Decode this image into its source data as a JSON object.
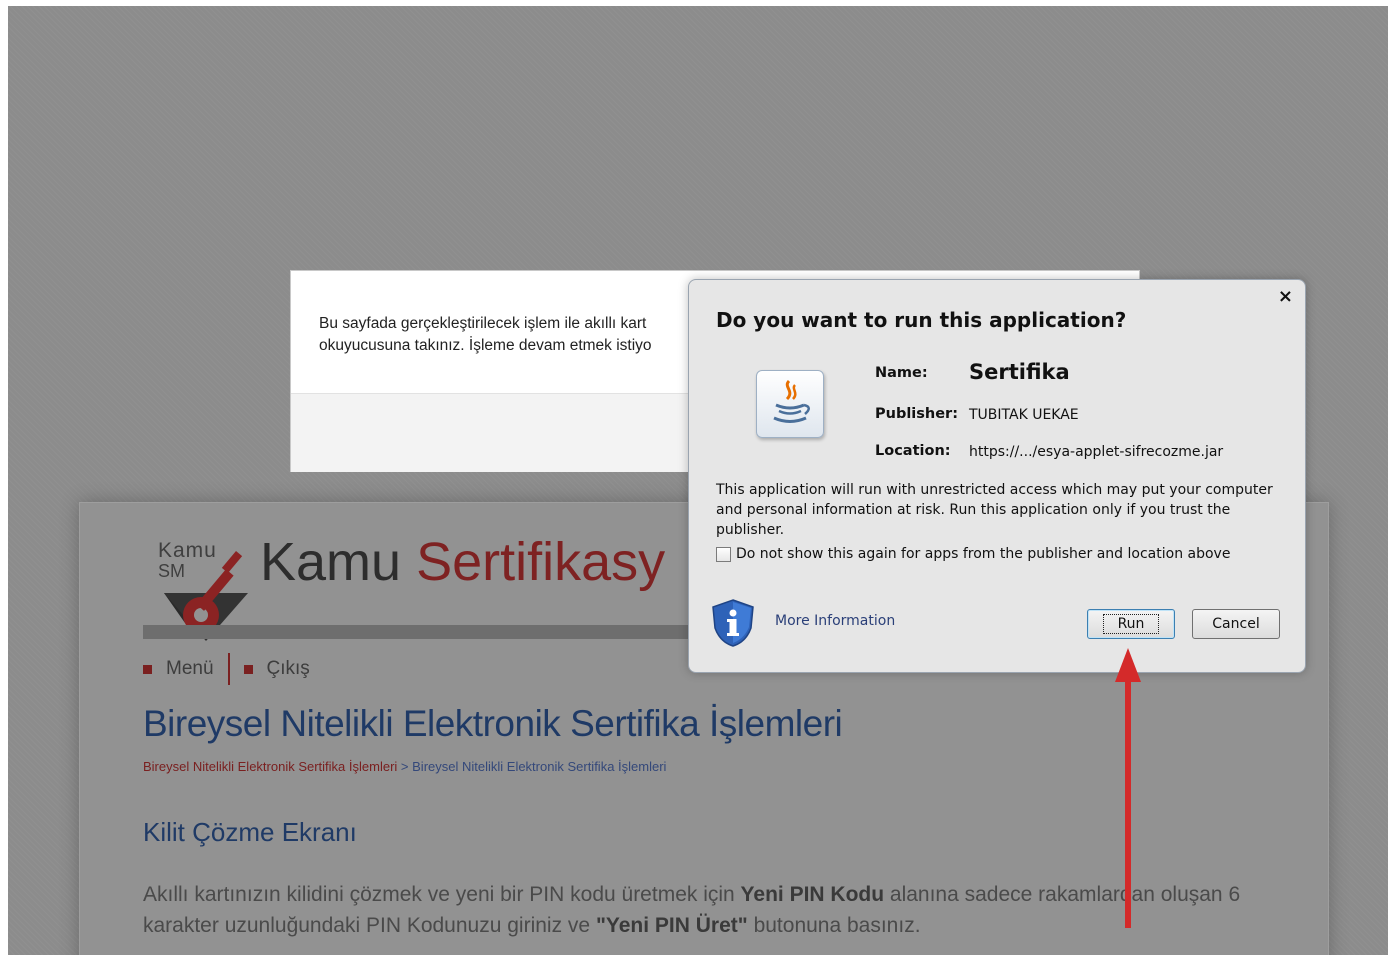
{
  "page": {
    "logo": {
      "small_top": "Kamu",
      "small_bottom": "SM"
    },
    "brand": {
      "part1": "Kamu",
      "part2": "Sertifikasy"
    },
    "nav": {
      "menu": "Menü",
      "exit": "Çıkış"
    },
    "page_title": "Bireysel Nitelikli Elektronik Sertifika İşlemleri",
    "breadcrumb": {
      "first": "Bireysel Nitelikli Elektronik Sertifika İşlemleri",
      "separator": ">",
      "second": "Bireysel Nitelikli Elektronik Sertifika İşlemleri"
    },
    "section_title": "Kilit Çözme Ekranı",
    "body": {
      "t1": "Akıllı kartınızın kilidini çözmek ve yeni bir PIN kodu üretmek için ",
      "b1": "Yeni PIN Kodu",
      "t2": " alanına sadece rakamlardan oluşan 6 karakter uzunluğundaki PIN Kodunuzu giriniz ve ",
      "b2": "\"Yeni PIN Üret\"",
      "t3": " butonuna basınız."
    }
  },
  "bg_modal": {
    "line1": "Bu sayfada gerçekleştirilecek işlem ile akıllı kart",
    "line2": "okuyucusuna takınız. İşleme devam etmek istiyo"
  },
  "java_dialog": {
    "close": "×",
    "title": "Do you want to run this application?",
    "name_label": "Name:",
    "name_value": "Sertifika",
    "publisher_label": "Publisher:",
    "publisher_value": "TUBITAK UEKAE",
    "location_label": "Location:",
    "location_value": "https://.../esya-applet-sifrecozme.jar",
    "warning": "This application will run with unrestricted access which may put your computer and personal information at risk. Run this application only if you trust the publisher.",
    "checkbox_label": "Do not show this again for apps from the publisher and location above",
    "checkbox_checked": false,
    "more_info": "More Information",
    "run_button": "Run",
    "cancel_button": "Cancel",
    "icons": {
      "app": "java-icon",
      "info": "shield-info-icon"
    }
  },
  "colors": {
    "overlay": "#8c8c8c",
    "brand_red": "#7e2222",
    "title_blue": "#1f3a66",
    "arrow_red": "#d42a2a"
  }
}
